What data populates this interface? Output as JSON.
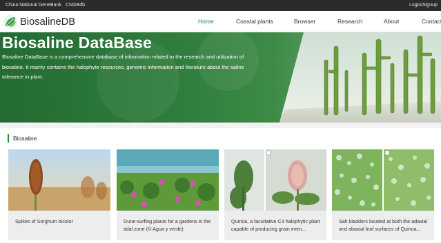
{
  "topbar": {
    "links": [
      "China National GeneBank",
      "CNGBdb"
    ],
    "login": "Login/Signup"
  },
  "brand": {
    "name": "BiosalineDB",
    "accent": "#1a8f3c"
  },
  "nav": {
    "items": [
      "Home",
      "Coastal plants",
      "Browser",
      "Research",
      "About",
      "Contact"
    ],
    "active": "Home"
  },
  "hero": {
    "title": "Biosaline DataBase",
    "description": "Biosaline DataBase is a comprehensive database of information related to the research and utilization of biosaline. It mainly contains the halophyte resources, genomic information and literature about the saline tolerance in plant."
  },
  "section": {
    "title": "Biosaline",
    "cards": [
      {
        "caption": "Spikes of Sorghum bicolor"
      },
      {
        "caption": "Dune-surfing plants for a gardens in the tidal zone (© Agua y verde)"
      },
      {
        "caption": "Quinoa, a facultative C3 halophytic plant capable of producing grain even..."
      },
      {
        "caption": "Salt bladders located at both the adaxial and abaxial leaf surfaces of Quinoa..."
      }
    ]
  }
}
